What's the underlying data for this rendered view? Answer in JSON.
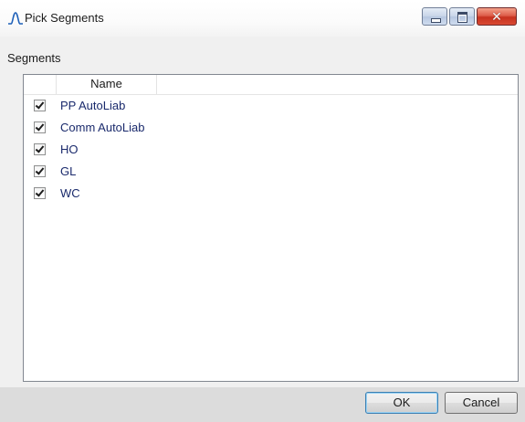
{
  "window": {
    "title": "Pick Segments",
    "icon": "bell-curve-icon",
    "controls": [
      "minimize",
      "maximize",
      "close"
    ]
  },
  "section": {
    "label": "Segments"
  },
  "list": {
    "columns": [
      "",
      "Name"
    ],
    "rows": [
      {
        "name": "PP AutoLiab",
        "checked": true
      },
      {
        "name": "Comm AutoLiab",
        "checked": true
      },
      {
        "name": "HO",
        "checked": true
      },
      {
        "name": "GL",
        "checked": true
      },
      {
        "name": "WC",
        "checked": true
      }
    ]
  },
  "buttons": {
    "ok": "OK",
    "cancel": "Cancel"
  },
  "colors": {
    "item_text": "#1a2a6c",
    "close_button": "#c7311e",
    "default_button_border": "#3c7fb1"
  }
}
